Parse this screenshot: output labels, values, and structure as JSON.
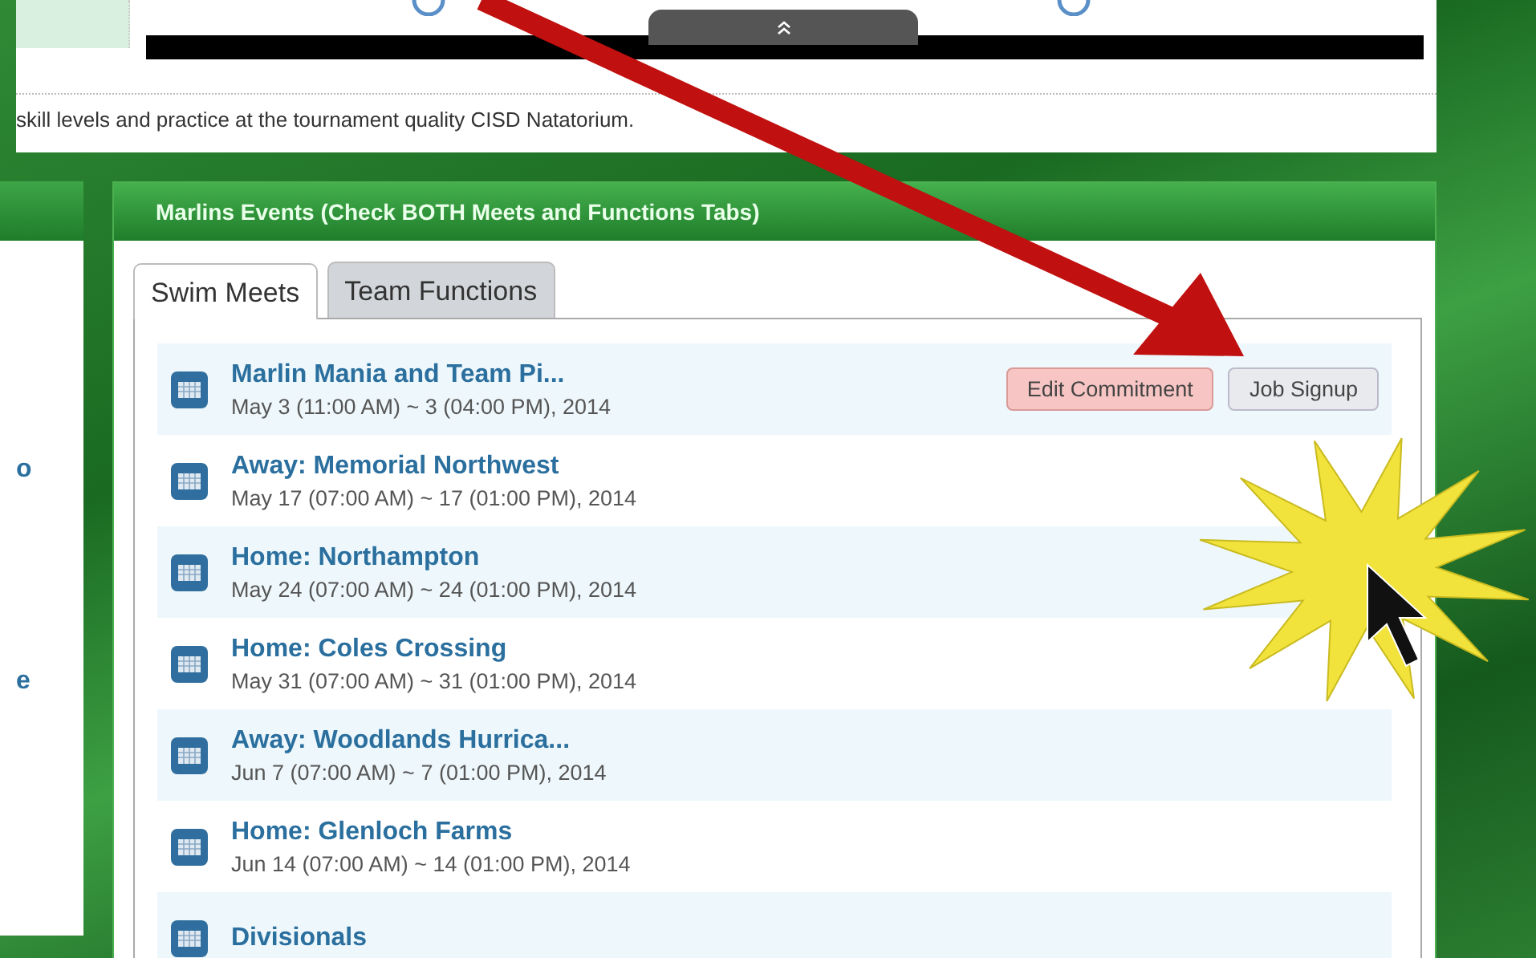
{
  "page": {
    "description": "skill levels and practice at the tournament quality CISD Natatorium."
  },
  "sidebar": {
    "items": [
      "o",
      "e"
    ]
  },
  "events_panel": {
    "title": "Marlins Events (Check BOTH Meets and Functions Tabs)",
    "tabs": [
      {
        "label": "Swim Meets",
        "selected": true
      },
      {
        "label": "Team Functions",
        "selected": false
      }
    ],
    "events": [
      {
        "name": "Marlin Mania and Team Pi...",
        "date": "May 3 (11:00 AM) ~ 3 (04:00 PM), 2014",
        "buttons": [
          {
            "label": "Edit Commitment",
            "kind": "warning"
          },
          {
            "label": "Job Signup",
            "kind": "default"
          }
        ]
      },
      {
        "name": "Away: Memorial Northwest",
        "date": "May 17 (07:00 AM) ~ 17 (01:00 PM), 2014"
      },
      {
        "name": "Home: Northampton",
        "date": "May 24 (07:00 AM) ~ 24 (01:00 PM), 2014"
      },
      {
        "name": "Home: Coles Crossing",
        "date": "May 31 (07:00 AM) ~ 31 (01:00 PM), 2014"
      },
      {
        "name": "Away: Woodlands Hurrica...",
        "date": "Jun 7 (07:00 AM) ~ 7 (01:00 PM), 2014"
      },
      {
        "name": "Home: Glenloch Farms",
        "date": "Jun 14 (07:00 AM) ~ 14 (01:00 PM), 2014"
      },
      {
        "name": "Divisionals"
      }
    ]
  }
}
